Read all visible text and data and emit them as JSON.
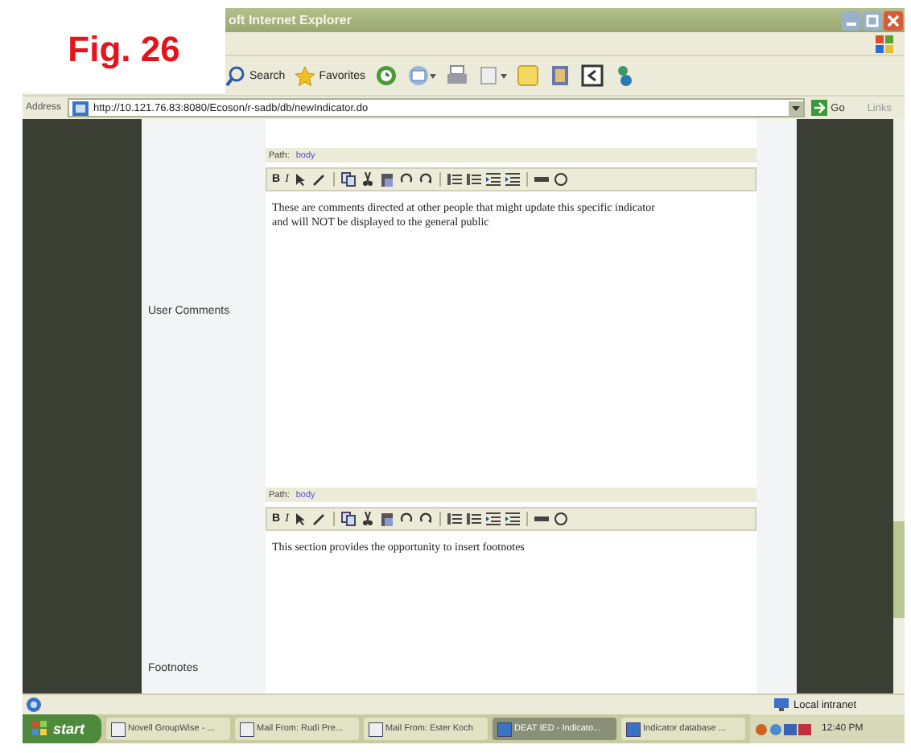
{
  "figure_label": "Fig. 26",
  "window": {
    "title": "oft Internet Explorer"
  },
  "toolbar": {
    "buttons": [
      {
        "label": "Search"
      },
      {
        "label": "Favorites"
      }
    ]
  },
  "address_bar": {
    "label": "Address",
    "url": "http://10.121.76.83:8080/Ecoson/r-sadb/db/newIndicator.do",
    "go_label": "Go",
    "links_label": "Links"
  },
  "form": {
    "sections": [
      {
        "label": "User Comments",
        "path_label": "Path:",
        "path_value": "body",
        "format_buttons": [
          "B",
          "I"
        ],
        "text": "These are comments directed at other people that might update this specific indicator and will NOT be displayed to the general public"
      },
      {
        "label": "Footnotes",
        "path_label": "Path:",
        "path_value": "body",
        "format_buttons": [
          "B",
          "I"
        ],
        "text": "This section provides the opportunity to insert footnotes"
      }
    ]
  },
  "status_bar": {
    "zone": "Local intranet"
  },
  "taskbar": {
    "start_label": "start",
    "tasks": [
      {
        "label": "Novell GroupWise - ...",
        "selected": false
      },
      {
        "label": "Mail From: Rudi Pre...",
        "selected": false
      },
      {
        "label": "Mail From: Ester Koch",
        "selected": false
      },
      {
        "label": "DEAT IED - Indicato...",
        "selected": true
      },
      {
        "label": "Indicator database ...",
        "selected": false
      }
    ],
    "clock": "12:40 PM"
  }
}
